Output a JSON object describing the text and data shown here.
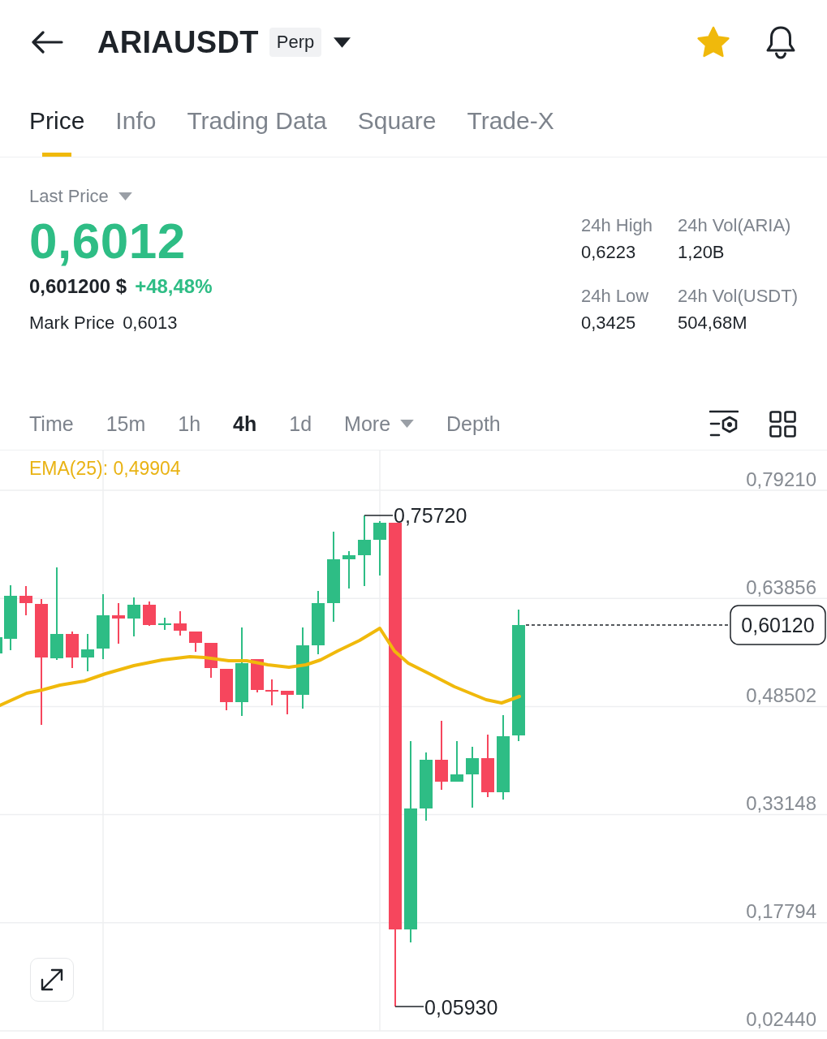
{
  "header": {
    "title": "ARIAUSDT",
    "badge": "Perp",
    "favorite": true
  },
  "tabs": [
    {
      "label": "Price",
      "selected": true
    },
    {
      "label": "Info",
      "selected": false
    },
    {
      "label": "Trading Data",
      "selected": false
    },
    {
      "label": "Square",
      "selected": false
    },
    {
      "label": "Trade-X",
      "selected": false
    }
  ],
  "price": {
    "label": "Last Price",
    "last": "0,6012",
    "usd": "0,601200 $",
    "change": "+48,48%",
    "mark_label": "Mark Price",
    "mark": "0,6013"
  },
  "stats": [
    {
      "label": "24h High",
      "value": "0,6223"
    },
    {
      "label": "24h Vol(ARIA)",
      "value": "1,20B"
    },
    {
      "label": "24h Low",
      "value": "0,3425"
    },
    {
      "label": "24h Vol(USDT)",
      "value": "504,68M"
    }
  ],
  "intervals": [
    {
      "label": "Time",
      "kind": "option",
      "selected": false
    },
    {
      "label": "15m",
      "kind": "option",
      "selected": false
    },
    {
      "label": "1h",
      "kind": "option",
      "selected": false
    },
    {
      "label": "4h",
      "kind": "option",
      "selected": true
    },
    {
      "label": "1d",
      "kind": "option",
      "selected": false
    },
    {
      "label": "More",
      "kind": "dropdown",
      "selected": false
    },
    {
      "label": "Depth",
      "kind": "option",
      "selected": false
    }
  ],
  "chart": {
    "ema_label": "EMA(25): 0,49904",
    "y_axis": [
      "0,79210",
      "0,63856",
      "0,48502",
      "0,33148",
      "0,17794",
      "0,02440"
    ],
    "high_label": "0,75720",
    "low_label": "0,05930",
    "last_price_tag": "0,60120"
  }
}
